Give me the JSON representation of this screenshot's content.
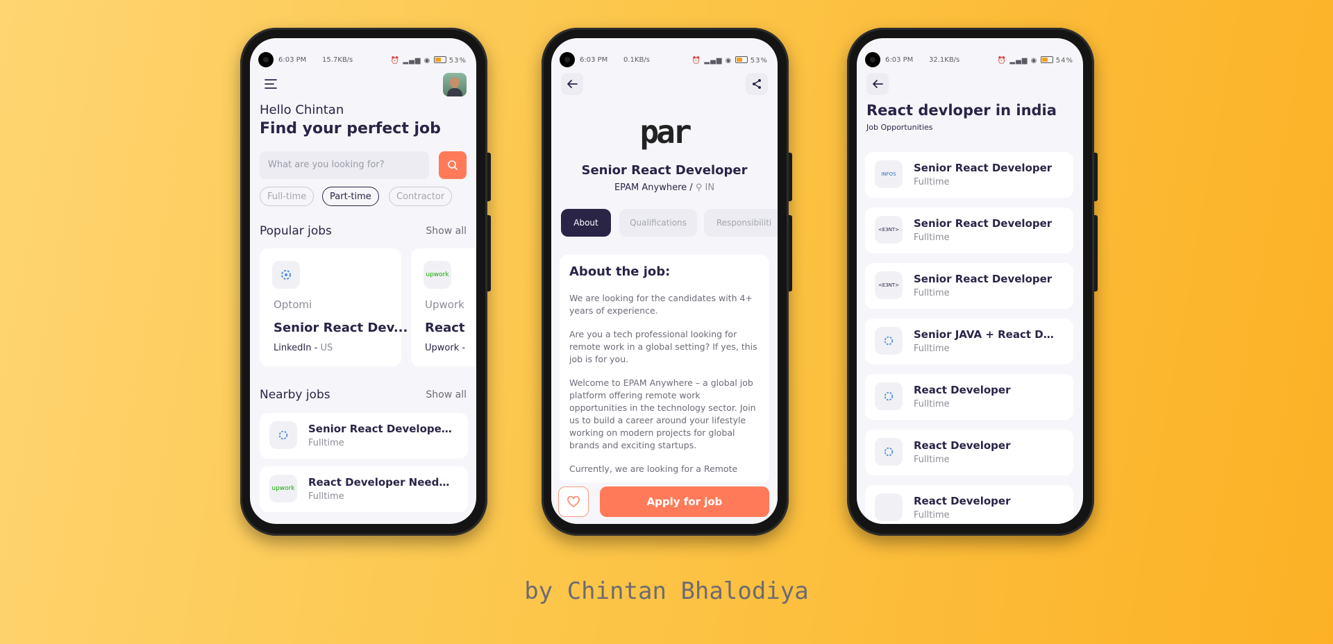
{
  "status_bar": {
    "phone1": {
      "time": "6:03 PM",
      "net": "15.7KB/s",
      "battery": "53%"
    },
    "phone2": {
      "time": "6:03 PM",
      "net": "0.1KB/s",
      "battery": "53%"
    },
    "phone3": {
      "time": "6:03 PM",
      "net": "32.1KB/s",
      "battery": "54%"
    }
  },
  "home": {
    "greeting": "Hello Chintan",
    "headline": "Find your perfect job",
    "search_placeholder": "What are you looking for?",
    "chips": [
      "Full-time",
      "Part-time",
      "Contractor"
    ],
    "popular_title": "Popular jobs",
    "popular_show_all": "Show all",
    "popular": [
      {
        "company": "Optomi",
        "title": "Senior React Dev...",
        "source": "LinkedIn",
        "location": "US"
      },
      {
        "company": "Upwork",
        "title": "React",
        "source": "Upwork -",
        "logo_text": "upwork"
      }
    ],
    "nearby_title": "Nearby jobs",
    "nearby_show_all": "Show all",
    "nearby": [
      {
        "title": "Senior React Developer (...",
        "type": "Fulltime"
      },
      {
        "title": "React Developer Needed...",
        "type": "Fulltime",
        "logo_text": "upwork"
      }
    ]
  },
  "detail": {
    "logo_text": "par",
    "job_title": "Senior React Developer",
    "company_line": "EPAM Anywhere /",
    "country": "IN",
    "tabs": [
      "About",
      "Qualifications",
      "Responsibiliti"
    ],
    "about_heading": "About the job:",
    "paragraphs": [
      "We are looking for the candidates with 4+ years of experience.",
      "Are you a tech professional looking for remote work in a global setting? If yes, this job is for you.",
      "Welcome to EPAM Anywhere – a global job platform offering remote work opportunities in the technology sector. Join us to build a career around your lifestyle working on modern projects for global brands and exciting startups.",
      "Currently, we are looking for a Remote"
    ],
    "apply_label": "Apply for job"
  },
  "search_results": {
    "title": "React devloper in india",
    "subtitle": "Job Opportunities",
    "items": [
      {
        "title": "Senior React Developer",
        "type": "Fulltime",
        "logo_text": "INFOS"
      },
      {
        "title": "Senior React Developer",
        "type": "Fulltime",
        "logo_text": "<E3NT>"
      },
      {
        "title": "Senior React Developer",
        "type": "Fulltime",
        "logo_text": "<E3NT>"
      },
      {
        "title": "Senior JAVA + React Deve...",
        "type": "Fulltime"
      },
      {
        "title": "React Developer",
        "type": "Fulltime"
      },
      {
        "title": "React Developer",
        "type": "Fulltime"
      },
      {
        "title": "React Developer",
        "type": "Fulltime"
      }
    ]
  },
  "credit": "by Chintan Bhalodiya",
  "colors": {
    "accent": "#ff7a59",
    "dark": "#2a2447",
    "bg_start": "#fed571",
    "bg_end": "#fcb125"
  }
}
